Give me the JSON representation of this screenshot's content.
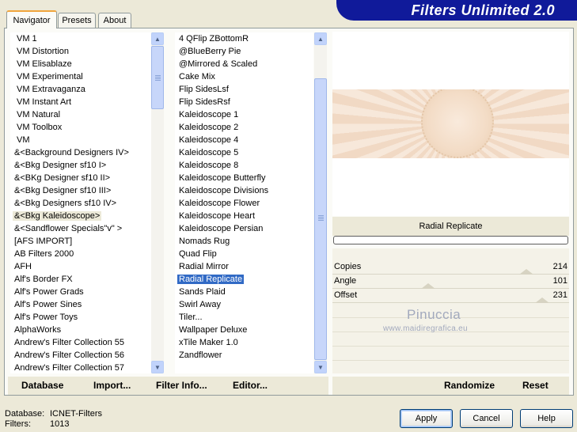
{
  "title": "Filters Unlimited 2.0",
  "tabs": [
    "Navigator",
    "Presets",
    "About"
  ],
  "categories": [
    "VM 1",
    "VM Distortion",
    "VM Elisablaze",
    "VM Experimental",
    "VM Extravaganza",
    "VM Instant Art",
    "VM Natural",
    "VM Toolbox",
    "VM",
    "&<Background Designers IV>",
    "&<Bkg Designer sf10 I>",
    "&<BKg Designer sf10 II>",
    "&<Bkg Designer sf10 III>",
    "&<Bkg Designers sf10 IV>",
    "&<Bkg Kaleidoscope>",
    "&<Sandflower Specials\"v\" >",
    "[AFS IMPORT]",
    "AB Filters 2000",
    "AFH",
    "Alf's Border FX",
    "Alf's Power Grads",
    "Alf's Power Sines",
    "Alf's Power Toys",
    "AlphaWorks",
    "Andrew's Filter Collection 55",
    "Andrew's Filter Collection 56",
    "Andrew's Filter Collection 57"
  ],
  "categories_selected": "&<Bkg Kaleidoscope>",
  "filters": [
    "4 QFlip ZBottomR",
    "@BlueBerry Pie",
    "@Mirrored & Scaled",
    "Cake Mix",
    "Flip SidesLsf",
    "Flip SidesRsf",
    "Kaleidoscope 1",
    "Kaleidoscope 2",
    "Kaleidoscope 4",
    "Kaleidoscope 5",
    "Kaleidoscope 8",
    "Kaleidoscope Butterfly",
    "Kaleidoscope Divisions",
    "Kaleidoscope Flower",
    "Kaleidoscope Heart",
    "Kaleidoscope Persian",
    "Nomads Rug",
    "Quad Flip",
    "Radial Mirror",
    "Radial Replicate",
    "Sands Plaid",
    "Swirl Away",
    "Tiler...",
    "Wallpaper Deluxe",
    "xTile Maker 1.0",
    "Zandflower"
  ],
  "filters_selected": "Radial Replicate",
  "current_filter": "Radial Replicate",
  "params": [
    {
      "name": "Copies",
      "value": "214",
      "level": 0.84
    },
    {
      "name": "Angle",
      "value": "101",
      "level": 0.4
    },
    {
      "name": "Offset",
      "value": "231",
      "level": 0.91
    }
  ],
  "watermark": {
    "name": "Pinuccia",
    "site": "www.maidiregrafica.eu"
  },
  "left_buttons": [
    "Database",
    "Import...",
    "Filter Info...",
    "Editor..."
  ],
  "right_buttons": [
    "Randomize",
    "Reset"
  ],
  "status": {
    "database_label": "Database:",
    "database_value": "ICNET-Filters",
    "filters_label": "Filters:",
    "filters_value": "1013"
  },
  "dialog_buttons": {
    "apply": "Apply",
    "cancel": "Cancel",
    "help": "Help"
  },
  "colors": {
    "banner": "#101a9a",
    "selection": "#316ac5",
    "tab_accent": "#f1a53c"
  }
}
